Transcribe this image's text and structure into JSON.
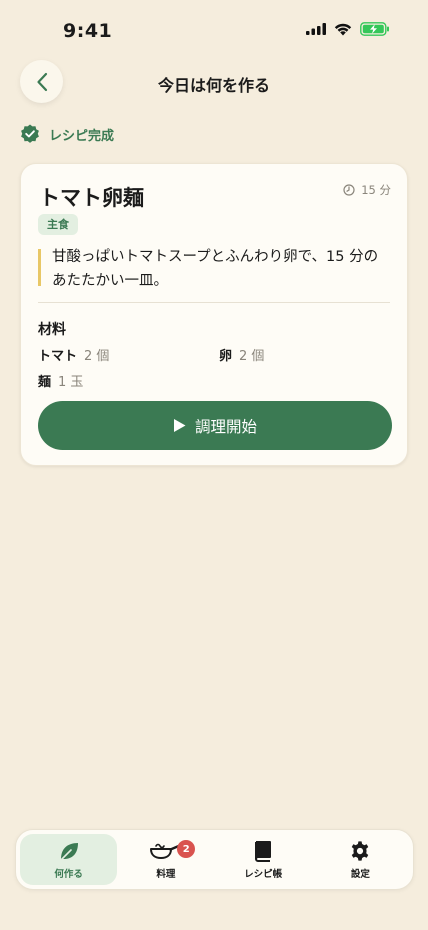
{
  "status_bar": {
    "time": "9:41"
  },
  "header": {
    "title": "今日は何を作る"
  },
  "recipe_status": {
    "label": "レシピ完成"
  },
  "recipe": {
    "name": "トマト卵麺",
    "time": "15 分",
    "category": "主食",
    "description": "甘酸っぱいトマトスープとふんわり卵で、15 分のあたたかい一皿。",
    "ingredients_heading": "材料",
    "ingredients": [
      {
        "name": "トマト",
        "qty": "2 個"
      },
      {
        "name": "卵",
        "qty": "2 個"
      },
      {
        "name": "麺",
        "qty": "1 玉"
      }
    ],
    "start_label": "調理開始"
  },
  "tabs": [
    {
      "label": "何作る",
      "icon": "leaf-icon",
      "active": true
    },
    {
      "label": "料理",
      "icon": "pan-icon",
      "badge": "2"
    },
    {
      "label": "レシピ帳",
      "icon": "book-icon"
    },
    {
      "label": "設定",
      "icon": "gear-icon"
    }
  ],
  "colors": {
    "background": "#f5eddd",
    "accent": "#3b7a53",
    "accent_soft": "#e3efe1",
    "quote_bar": "#e8c766",
    "badge": "#d9534f",
    "battery": "#34c759"
  }
}
